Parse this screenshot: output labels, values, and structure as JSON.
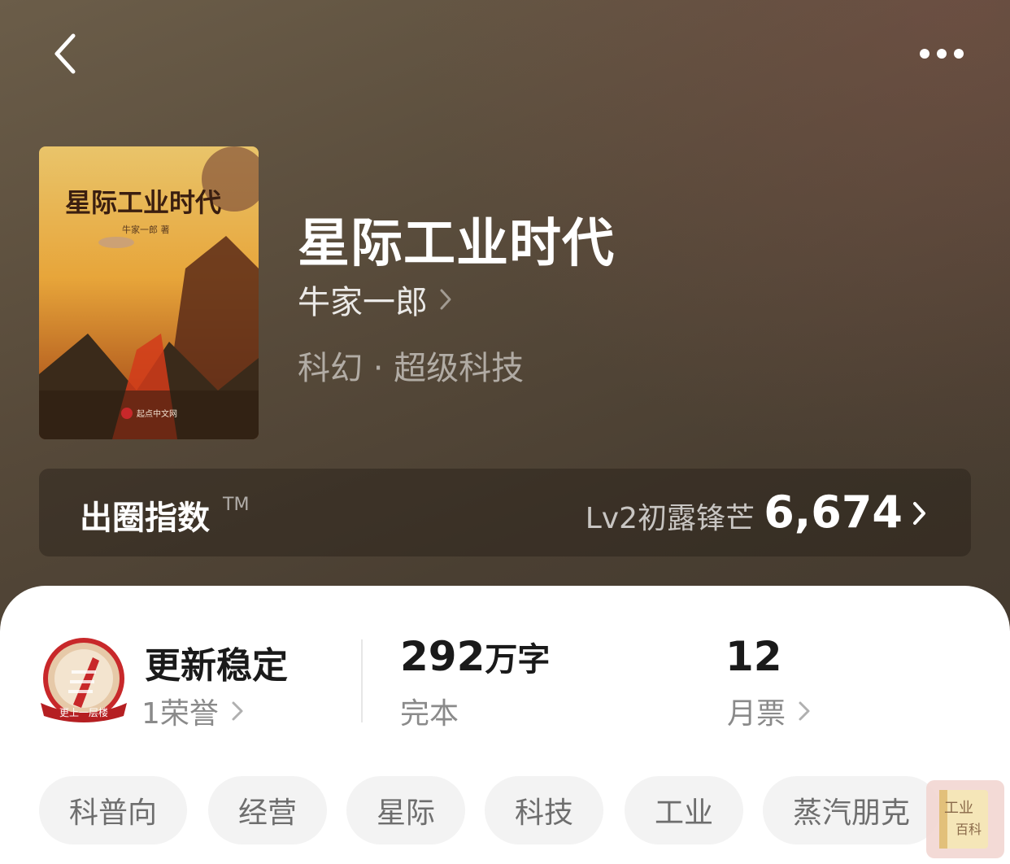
{
  "header": {
    "back_icon": "chevron-left-icon",
    "more_icon": "more-dots-icon"
  },
  "book": {
    "cover": {
      "title_text": "星际工业时代",
      "author_text": "牛家一郎 著",
      "publisher_text": "起点中文网"
    },
    "title": "星际工业时代",
    "author": "牛家一郎",
    "genre": "科幻 · 超级科技"
  },
  "index_bar": {
    "label": "出圈指数",
    "tm": "TM",
    "level": "Lv2初露锋芒",
    "score": "6,674"
  },
  "stats": {
    "honor": {
      "badge_text": "更上一层楼",
      "title": "更新稳定",
      "count": "1荣誉"
    },
    "words": {
      "number": "292",
      "unit": "万字",
      "status": "完本"
    },
    "tickets": {
      "number": "12",
      "label": "月票"
    }
  },
  "tags": [
    "科普向",
    "经营",
    "星际",
    "科技",
    "工业",
    "蒸汽朋克"
  ],
  "watermark": {
    "line1": "工业",
    "line2": "百科"
  },
  "colors": {
    "hero_bg": "#574a3a",
    "panel_bg": "#ffffff",
    "tag_bg": "#f3f3f3",
    "badge_red": "#c8282a"
  }
}
